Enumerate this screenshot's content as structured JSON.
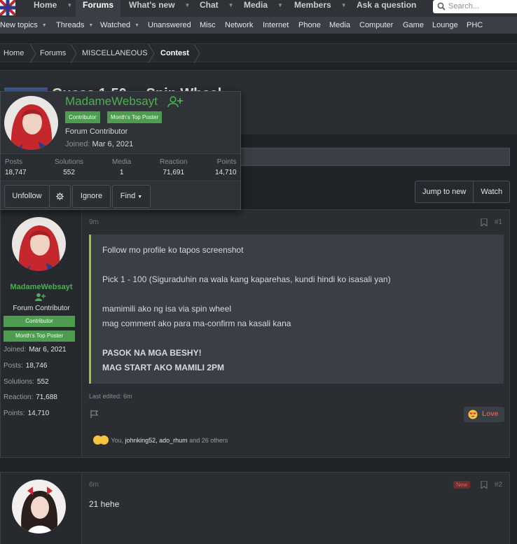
{
  "nav": {
    "tabs": [
      {
        "label": "Home"
      },
      {
        "label": "Forums"
      },
      {
        "label": "What's new"
      },
      {
        "label": "Chat"
      },
      {
        "label": "Media"
      },
      {
        "label": "Members"
      },
      {
        "label": "Ask a question"
      }
    ],
    "search_placeholder": "Search..."
  },
  "subnav": {
    "items": [
      "New topics",
      "Threads",
      "Watched",
      "Unanswered",
      "Misc",
      "Network",
      "Internet",
      "Phone",
      "Media",
      "Computer",
      "Game",
      "Lounge",
      "PHC"
    ]
  },
  "breadcrumb": [
    "Home",
    "Forums",
    "MISCELLANEOUS",
    "Contest"
  ],
  "thread": {
    "title_partial": "Guess 1-50 ... Spin Wheel"
  },
  "buttons": {
    "jump_new": "Jump to new",
    "watch": "Watch"
  },
  "member_card": {
    "name": "MadameWebsayt",
    "badges": [
      "Contributor",
      "Month's Top Poster"
    ],
    "title": "Forum Contributor",
    "joined_label": "Joined:",
    "joined": "Mar 6, 2021",
    "stats": [
      {
        "k": "Posts",
        "v": "18,747"
      },
      {
        "k": "Solutions",
        "v": "552"
      },
      {
        "k": "Media",
        "v": "1"
      },
      {
        "k": "Reaction",
        "v": "71,691"
      },
      {
        "k": "Points",
        "v": "14,710"
      }
    ],
    "actions": {
      "unfollow": "Unfollow",
      "ignore": "Ignore",
      "find": "Find"
    }
  },
  "post1": {
    "time": "9m",
    "num": "#1",
    "author": {
      "name": "MadameWebsayt",
      "title": "Forum Contributor",
      "badges": [
        "Contributor",
        "Month's Top Poster"
      ],
      "stats": [
        {
          "k": "Joined:",
          "v": "Mar 6, 2021"
        },
        {
          "k": "Posts:",
          "v": "18,746"
        },
        {
          "k": "Solutions:",
          "v": "552"
        },
        {
          "k": "Reaction:",
          "v": "71,688"
        },
        {
          "k": "Points:",
          "v": "14,710"
        }
      ]
    },
    "lines": [
      "Follow mo profile ko tapos screenshot",
      "Pick 1 - 100 (Siguraduhin na wala kang kaparehas, kundi hindi ko isasali yan)",
      "mamimili ako ng isa via spin wheel",
      "mag comment ako para ma-confirm na kasali kana",
      "PASOK NA MGA BESHY!",
      "MAG START AKO MAMILI 2PM"
    ],
    "edited": "Last edited: 6m",
    "love": "Love",
    "reactions": {
      "you": "You,",
      "u1": "johnking52",
      "comma": ",",
      "u2": "ado_rhum",
      "rest": "and 26 others"
    }
  },
  "post2": {
    "time": "6m",
    "new": "New",
    "num": "#2",
    "text": "21 hehe"
  },
  "colors": {
    "accent_green": "#4caf50",
    "quote_bar": "#9cc23f",
    "love": "#e05454"
  }
}
